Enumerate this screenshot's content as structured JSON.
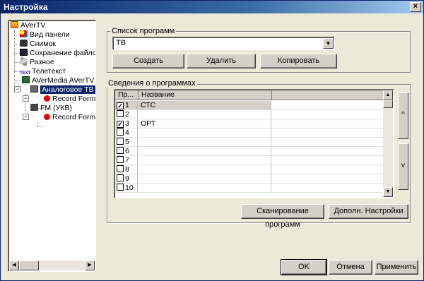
{
  "window": {
    "title": "Настройка",
    "close_glyph": "×"
  },
  "tree": {
    "items": [
      {
        "label": "AVerTV",
        "icon": "app-icon"
      },
      {
        "label": "Вид панели",
        "icon": "panel-icon"
      },
      {
        "label": "Снимок",
        "icon": "camera-icon"
      },
      {
        "label": "Сохранение файлов",
        "icon": "save-icon"
      },
      {
        "label": "Разное",
        "icon": "misc-icon"
      },
      {
        "label": "Телетекст",
        "icon": "teletext-icon",
        "badge": "TEXT"
      },
      {
        "label": "AVerMedia AVerTV M",
        "icon": "device-icon"
      },
      {
        "label": "Аналоговое ТВ",
        "icon": "tv-icon",
        "selected": true
      },
      {
        "label": "Record Forma",
        "icon": "record-icon"
      },
      {
        "label": "FM (УКВ)",
        "icon": "radio-icon"
      },
      {
        "label": "Record Forma",
        "icon": "record-icon"
      }
    ],
    "expand_minus": "−",
    "scroll_left": "◀",
    "scroll_right": "▶"
  },
  "program_list": {
    "legend": "Список программ",
    "combo_value": "ТВ",
    "combo_arrow": "▼",
    "create_label": "Создать",
    "delete_label": "Удалить",
    "copy_label": "Копировать"
  },
  "program_info": {
    "legend": "Сведения о программах",
    "columns": [
      "Пр...",
      "Название",
      ""
    ],
    "rows": [
      {
        "num": "1",
        "checked": true,
        "name": "СТС"
      },
      {
        "num": "2",
        "checked": false,
        "name": ""
      },
      {
        "num": "3",
        "checked": true,
        "name": "ОРТ"
      },
      {
        "num": "4",
        "checked": false,
        "name": ""
      },
      {
        "num": "5",
        "checked": false,
        "name": ""
      },
      {
        "num": "6",
        "checked": false,
        "name": ""
      },
      {
        "num": "7",
        "checked": false,
        "name": ""
      },
      {
        "num": "8",
        "checked": false,
        "name": ""
      },
      {
        "num": "9",
        "checked": false,
        "name": ""
      },
      {
        "num": "10",
        "checked": false,
        "name": ""
      }
    ],
    "check_glyph": "✓",
    "scroll_up": "▲",
    "scroll_down": "▼",
    "move_up_glyph": "^",
    "move_down_glyph": "v",
    "scan_label": "Сканирование программ",
    "advanced_label": "Дополн. Настройки"
  },
  "footer": {
    "ok_label": "OK",
    "cancel_label": "Отмена",
    "apply_label": "Применить"
  },
  "colors": {
    "selection": "#0a246a",
    "face": "#ece9d8",
    "button": "#d4d0c8"
  }
}
